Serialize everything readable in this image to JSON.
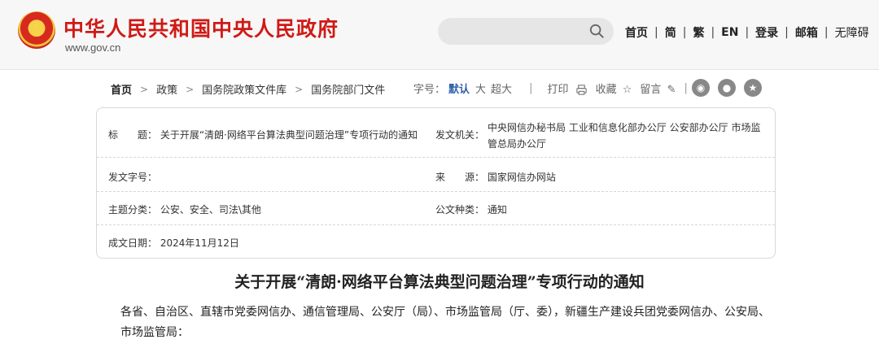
{
  "header": {
    "site_title": "中华人民共和国中央人民政府",
    "site_url": "www.gov.cn",
    "nav": [
      "首页",
      "简",
      "繁",
      "EN",
      "登录",
      "邮箱",
      "无障碍"
    ]
  },
  "breadcrumb": [
    "首页",
    "政策",
    "国务院政策文件库",
    "国务院部门文件"
  ],
  "toolbar": {
    "font_label": "字号：",
    "font_default": "默认",
    "font_large": "大",
    "font_xlarge": "超大",
    "print": "打印",
    "favorite": "收藏",
    "comment": "留言"
  },
  "info": {
    "title_label": "标　　题：",
    "title_value": "关于开展“清朗·网络平台算法典型问题治理”专项行动的通知",
    "issuer_label": "发文机关：",
    "issuer_value_line1": "中央网信办秘书局 工业和信息化部办公厅 公安部办公厅 市场监",
    "issuer_value_line2": "管总局办公厅",
    "docno_label": "发文字号：",
    "docno_value": "",
    "source_label": "来　　源：",
    "source_value": "国家网信办网站",
    "topic_label": "主题分类：",
    "topic_value": "公安、安全、司法\\其他",
    "type_label": "公文种类：",
    "type_value": "通知",
    "date_label": "成文日期：",
    "date_value": "2024年11月12日"
  },
  "document": {
    "title": "关于开展“清朗·网络平台算法典型问题治理”专项行动的通知",
    "body_line1": "各省、自治区、直辖市党委网信办、通信管理局、公安厅（局）、市场监管局（厅、委），新疆生产建设兵团党委网信办、公安局、",
    "body_line2": "市场监管局："
  },
  "colors": {
    "brand_red": "#cf1a16",
    "link_blue": "#2c5fa8"
  }
}
